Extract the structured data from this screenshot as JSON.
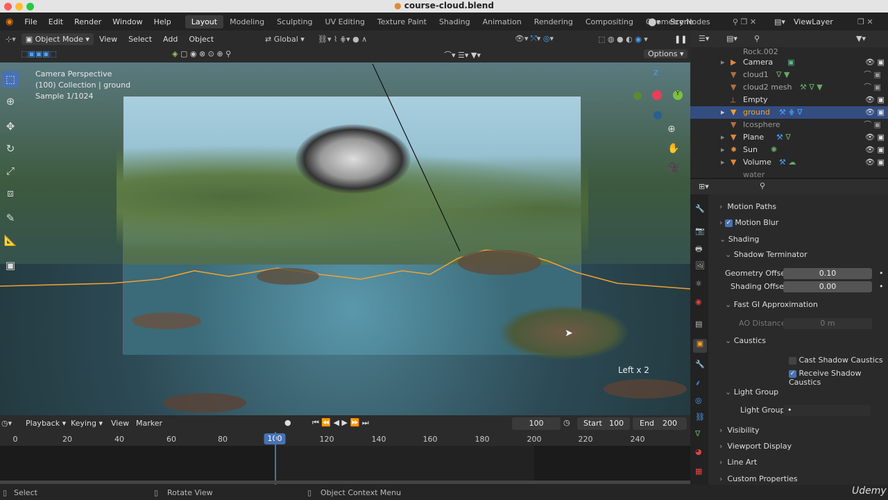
{
  "window": {
    "title": "course-cloud.blend"
  },
  "menu": {
    "file": "File",
    "edit": "Edit",
    "render": "Render",
    "window": "Window",
    "help": "Help"
  },
  "workspaces": [
    "Layout",
    "Modeling",
    "Sculpting",
    "UV Editing",
    "Texture Paint",
    "Shading",
    "Animation",
    "Rendering",
    "Compositing",
    "Geometry Nodes"
  ],
  "scene": {
    "name": "Scene",
    "view_layer": "ViewLayer"
  },
  "viewport_header": {
    "mode": "Object Mode",
    "view": "View",
    "select": "Select",
    "add": "Add",
    "object": "Object",
    "orientation": "Global",
    "options": "Options"
  },
  "overlay": {
    "line1": "Camera Perspective",
    "line2": "(100) Collection | ground",
    "line3": "Sample 1/1024",
    "operator": "Left x 2"
  },
  "outliner": {
    "items": [
      {
        "name": "Rock.002"
      },
      {
        "name": "Camera"
      },
      {
        "name": "cloud1"
      },
      {
        "name": "cloud2 mesh"
      },
      {
        "name": "Empty"
      },
      {
        "name": "ground"
      },
      {
        "name": "Icosphere"
      },
      {
        "name": "Plane"
      },
      {
        "name": "Sun"
      },
      {
        "name": "Volume"
      },
      {
        "name": "water"
      }
    ]
  },
  "properties": {
    "motion_paths": "Motion Paths",
    "motion_blur": "Motion Blur",
    "shading": "Shading",
    "shadow_terminator": "Shadow Terminator",
    "geometry_offset_label": "Geometry Offset",
    "geometry_offset_value": "0.10",
    "shading_offset_label": "Shading Offset",
    "shading_offset_value": "0.00",
    "fast_gi": "Fast GI Approximation",
    "ao_distance_label": "AO Distance",
    "ao_distance_value": "0 m",
    "caustics": "Caustics",
    "cast_shadow_caustics": "Cast Shadow Caustics",
    "receive_shadow_caustics": "Receive Shadow Caustics",
    "light_group": "Light Group",
    "light_group_label": "Light Group",
    "visibility": "Visibility",
    "viewport_display": "Viewport Display",
    "line_art": "Line Art",
    "custom_properties": "Custom Properties"
  },
  "timeline": {
    "playback": "Playback",
    "keying": "Keying",
    "view": "View",
    "marker": "Marker",
    "current_frame": "100",
    "start_label": "Start",
    "start": "100",
    "end_label": "End",
    "end": "200",
    "ticks": [
      "0",
      "20",
      "40",
      "60",
      "80",
      "100",
      "120",
      "140",
      "160",
      "180",
      "200",
      "220",
      "240"
    ]
  },
  "statusbar": {
    "select": "Select",
    "rotate": "Rotate View",
    "context": "Object Context Menu"
  },
  "watermark": "Udemy",
  "colors": {
    "accent": "#4772b3",
    "selected_row": "#334d80",
    "orange_outline": "#f0a030",
    "current_frame": "#4772b3"
  }
}
